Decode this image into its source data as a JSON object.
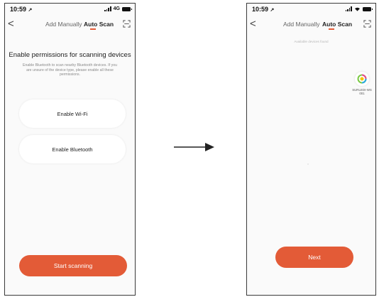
{
  "left_screen": {
    "status": {
      "time": "10:59",
      "network": "4G"
    },
    "nav": {
      "back": "<",
      "tab_manual": "Add Manually",
      "tab_auto": "Auto Scan"
    },
    "title": "Enable permissions for scanning devices",
    "description": "Enable Bluetooth to scan nearby Bluetooth devices. If you are unsure of the device type, please enable all these permissions.",
    "wifi_button": "Enable Wi-Fi",
    "bluetooth_button": "Enable Bluetooth",
    "start_button": "Start scanning"
  },
  "right_screen": {
    "status": {
      "time": "10:59"
    },
    "nav": {
      "back": "<",
      "tab_manual": "Add Manually",
      "tab_auto": "Auto Scan"
    },
    "found_label": "Available devices found",
    "device": {
      "label_line1": "SURLEDI-WS",
      "label_line2": "001"
    },
    "next_button": "Next"
  },
  "colors": {
    "accent": "#e35b37",
    "background": "#fafafa"
  },
  "icons": {
    "location": "location-arrow-icon",
    "scan": "scan-frame-icon",
    "battery": "battery-icon",
    "signal": "signal-icon",
    "wifi": "wifi-icon",
    "transition": "right-arrow-icon"
  }
}
